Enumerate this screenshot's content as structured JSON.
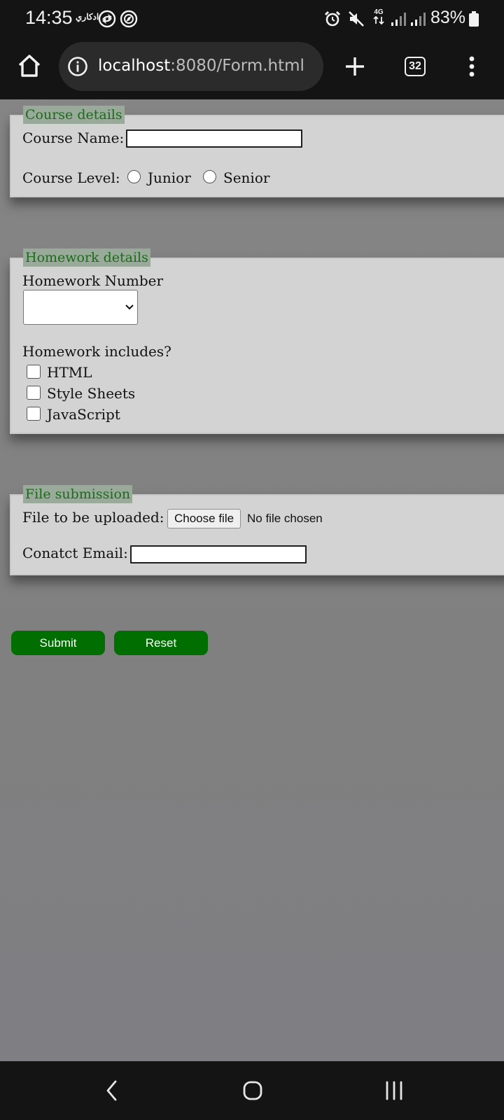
{
  "status_bar": {
    "time": "14:35",
    "app_label": "ادكاري",
    "network_type": "4G",
    "battery_percent": "83%",
    "icons": [
      "sync-icon",
      "compass-icon",
      "alarm-icon",
      "mute-icon",
      "data-arrows-icon",
      "signal-icon",
      "signal-icon",
      "battery-icon"
    ]
  },
  "browser": {
    "url_host": "localhost",
    "url_path": ":8080/Form.html",
    "tab_count": "32",
    "icons": [
      "home-icon",
      "info-icon",
      "plus-icon",
      "tabs-icon",
      "more-vert-icon"
    ]
  },
  "form": {
    "course": {
      "legend": "Course details",
      "name_label": "Course Name:",
      "name_value": "",
      "level_label": "Course Level:",
      "level_options": [
        "Junior",
        "Senior"
      ]
    },
    "homework": {
      "legend": "Homework details",
      "number_label": "Homework Number",
      "number_selected": "",
      "includes_label": "Homework includes?",
      "includes_options": [
        "HTML",
        "Style Sheets",
        "JavaScript"
      ]
    },
    "submission": {
      "legend": "File submission",
      "file_label": "File to be uploaded:",
      "choose_file_button": "Choose file",
      "file_status": "No file chosen",
      "email_label": "Conatct Email:",
      "email_value": ""
    },
    "buttons": {
      "submit": "Submit",
      "reset": "Reset"
    },
    "colors": {
      "page_background": "#808080",
      "fieldset_background": "#d3d3d3",
      "legend_text": "#1a6b1a",
      "legend_background": "#9aaa9a",
      "button_background": "#006e00",
      "button_text": "#ffffff"
    }
  },
  "nav_bar": {
    "icons": [
      "back-icon",
      "home-circle-icon",
      "recents-icon"
    ]
  }
}
